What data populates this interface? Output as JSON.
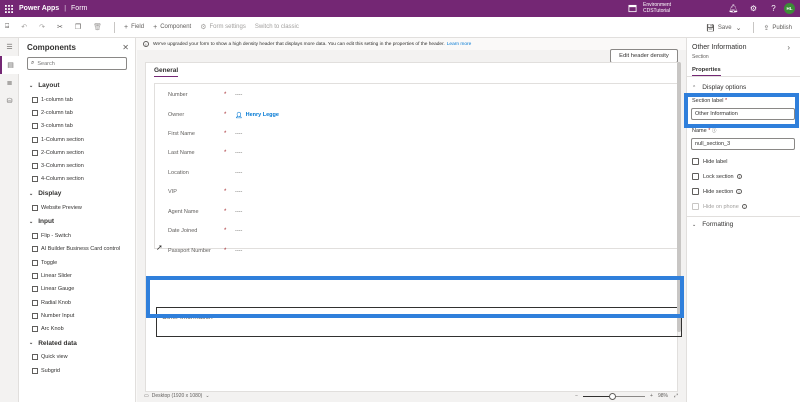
{
  "topbar": {
    "brand": "Power Apps",
    "separator": "|",
    "form_label": "Form",
    "env_label": "Environment",
    "env_name": "CDSTutorial",
    "avatar_initials": "HL"
  },
  "cmdbar": {
    "field": "Field",
    "component": "Component",
    "form_settings": "Form settings",
    "switch_classic": "Switch to classic",
    "save": "Save",
    "publish": "Publish"
  },
  "components": {
    "title": "Components",
    "search_placeholder": "Search",
    "groups": [
      {
        "label": "Layout",
        "items": [
          "1-column tab",
          "2-column tab",
          "3-column tab",
          "1-Column section",
          "2-Column section",
          "3-Column section",
          "4-Column section"
        ]
      },
      {
        "label": "Display",
        "items": [
          "Website Preview"
        ]
      },
      {
        "label": "Input",
        "items": [
          "Flip - Switch",
          "AI Builder Business Card control",
          "Toggle",
          "Linear Slider",
          "Linear Gauge",
          "Radial Knob",
          "Number Input",
          "Arc Knob"
        ]
      },
      {
        "label": "Related data",
        "items": [
          "Quick view",
          "Subgrid"
        ]
      }
    ]
  },
  "canvas": {
    "banner": "We've upgraded your form to show a high density header that displays more data. You can edit this setting in the properties of the header.",
    "learn_more": "Learn more",
    "header_density": "Edit header density",
    "tab": "General",
    "fields": [
      {
        "label": "Number",
        "req": "*",
        "value": "----"
      },
      {
        "label": "Owner",
        "req": "*",
        "value": "Henry Legge",
        "person": true
      },
      {
        "label": "First Name",
        "req": "*",
        "value": "----"
      },
      {
        "label": "Last Name",
        "req": "*",
        "value": "----"
      },
      {
        "label": "Location",
        "req": "",
        "value": "----"
      },
      {
        "label": "VIP",
        "req": "*",
        "value": "----"
      },
      {
        "label": "Agent Name",
        "req": "*",
        "value": "----"
      },
      {
        "label": "Date Joined",
        "req": "*",
        "value": "----"
      },
      {
        "label": "Passport Number",
        "req": "*",
        "value": "----"
      }
    ],
    "other_section": "Other Information",
    "device": "Desktop (1920 x 1080)",
    "zoom": "98%",
    "zoom_fraction": 0.47
  },
  "props": {
    "title": "Other Information",
    "subtitle": "Section",
    "tab": "Properties",
    "display_options": "Display options",
    "section_label": "Section label",
    "section_label_value": "Other Information",
    "name_label": "Name",
    "name_value": "null_section_3",
    "hide_label": "Hide label",
    "lock_section": "Lock section",
    "hide_section": "Hide section",
    "hide_on_phone": "Hide on phone",
    "formatting": "Formatting"
  }
}
